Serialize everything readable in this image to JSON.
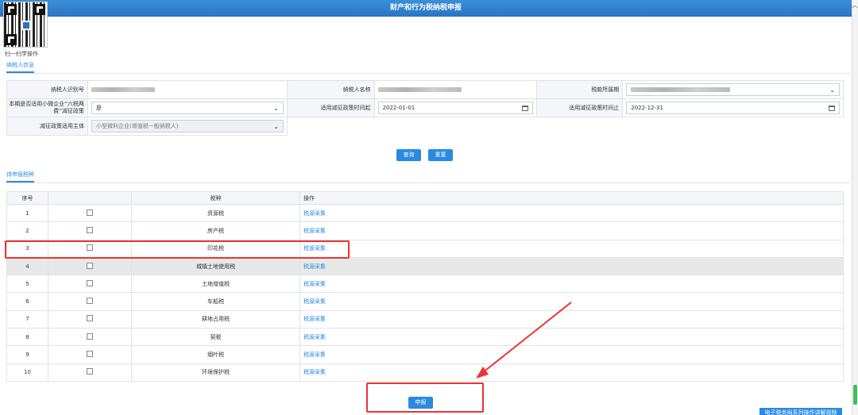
{
  "window": {
    "title": "财产和行为税纳税申报"
  },
  "qr": {
    "label": "扫一扫学操作"
  },
  "tabs": {
    "taxpayer_info": "纳税人信息",
    "pending_taxes": "待申报税种"
  },
  "form": {
    "taxpayer_id_label": "纳税人识别号",
    "taxpayer_name_label": "纳税人名称",
    "period_label": "税款所属期",
    "small_micro_label": "本期是否适用小微企业“六税两费”减征政策",
    "small_micro_value": "是",
    "policy_start_label": "适用减征政策时间起",
    "policy_start_value": "2022-01-01",
    "policy_end_label": "适用减征政策时间止",
    "policy_end_value": "2022-12-31",
    "subject_label": "减征政策适用主体",
    "subject_value": "小型微利企业(增值税一般纳税人)"
  },
  "buttons": {
    "query": "查询",
    "reset": "重置",
    "declare": "申报",
    "bottom": "电子税务局系列操作讲解视频"
  },
  "table": {
    "headers": [
      "序号",
      "",
      "税种",
      "操作"
    ],
    "rows": [
      {
        "no": "1",
        "tax": "资源税",
        "action": "税源采集"
      },
      {
        "no": "2",
        "tax": "房产税",
        "action": "税源采集"
      },
      {
        "no": "3",
        "tax": "印花税",
        "action": "税源采集"
      },
      {
        "no": "4",
        "tax": "城镇土地使用税",
        "action": "税源采集"
      },
      {
        "no": "5",
        "tax": "土地增值税",
        "action": "税源采集"
      },
      {
        "no": "6",
        "tax": "车船税",
        "action": "税源采集"
      },
      {
        "no": "7",
        "tax": "耕地占用税",
        "action": "税源采集"
      },
      {
        "no": "8",
        "tax": "契税",
        "action": "税源采集"
      },
      {
        "no": "9",
        "tax": "烟叶税",
        "action": "税源采集"
      },
      {
        "no": "10",
        "tax": "环境保护税",
        "action": "税源采集"
      }
    ]
  },
  "colors": {
    "accent": "#2a8ae0",
    "highlight": "#e33333"
  }
}
